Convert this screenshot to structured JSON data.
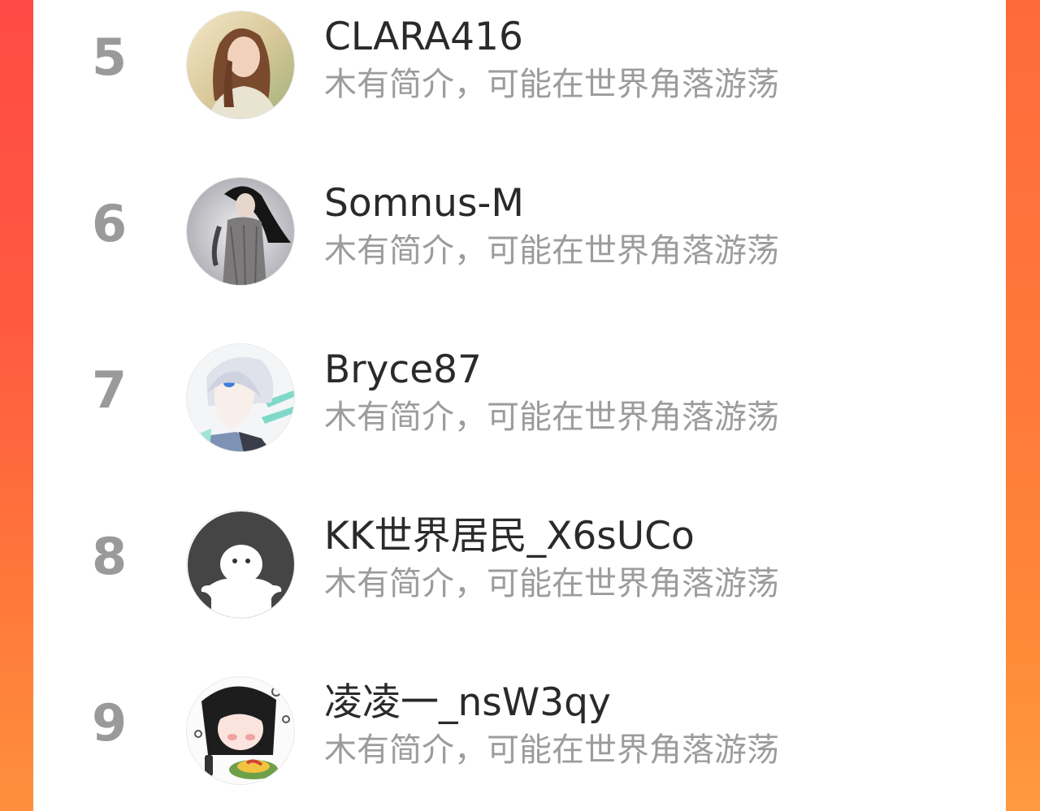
{
  "ranking": {
    "items": [
      {
        "rank": "5",
        "name": "CLARA416",
        "bio": "木有简介，可能在世界角落游荡",
        "avatar_icon": "user-avatar-photo-woman"
      },
      {
        "rank": "6",
        "name": "Somnus-M",
        "bio": "木有简介，可能在世界角落游荡",
        "avatar_icon": "user-avatar-photo-woman-dark-hair"
      },
      {
        "rank": "7",
        "name": "Bryce87",
        "bio": "木有简介，可能在世界角落游荡",
        "avatar_icon": "user-avatar-anime-white-hair"
      },
      {
        "rank": "8",
        "name": "KK世界居民_X6sUCo",
        "bio": "木有简介，可能在世界角落游荡",
        "avatar_icon": "default-avatar-icon"
      },
      {
        "rank": "9",
        "name": "凌凌一_nsW3qy",
        "bio": "木有简介，可能在世界角落游荡",
        "avatar_icon": "user-avatar-cartoon-girl"
      }
    ]
  },
  "colors": {
    "background_accent": "#ff5a40",
    "card": "#ffffff",
    "rank_text": "#9a9a9a",
    "name_text": "#2a2a2a",
    "bio_text": "#9c9c9c"
  }
}
